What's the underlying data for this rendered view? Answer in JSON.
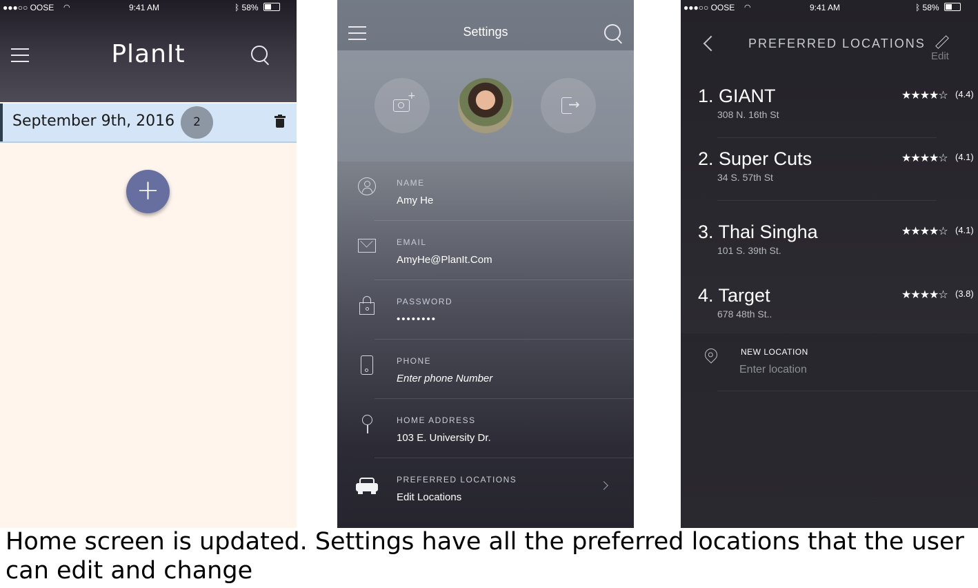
{
  "home": {
    "status": {
      "carrier": "●●●○○ OOSE",
      "time": "9:41 AM",
      "battery": "58%"
    },
    "title": "PlanIt",
    "date_label": "September 9th, 2016",
    "event_count": "2",
    "add_symbol": "+"
  },
  "settings": {
    "title": "Settings",
    "camera_plus": "+",
    "logout_arrow": "→",
    "fields": [
      {
        "label": "NAME",
        "value": "Amy He"
      },
      {
        "label": "EMAIL",
        "value": "AmyHe@PlanIt.Com"
      },
      {
        "label": "PASSWORD",
        "value": "••••••••"
      },
      {
        "label": "PHONE",
        "value": "Enter phone Number"
      },
      {
        "label": "HOME ADDRESS",
        "value": "103 E. University Dr."
      },
      {
        "label": "PREFERRED LOCATIONS",
        "value": "Edit Locations"
      }
    ]
  },
  "locations": {
    "status": {
      "carrier": "●●●○○ OOSE",
      "time": "9:41 AM",
      "battery": "58%"
    },
    "title": "PREFERRED LOCATIONS",
    "edit_label": "Edit",
    "items": [
      {
        "name": "1. GIANT",
        "address": "308 N. 16th St",
        "stars": "★★★★☆",
        "rating": "(4.4)"
      },
      {
        "name": "2. Super Cuts",
        "address": "34 S. 57th St",
        "stars": "★★★★☆",
        "rating": "(4.1)"
      },
      {
        "name": "3. Thai Singha",
        "address": "101 S. 39th St.",
        "stars": "★★★★☆",
        "rating": "(4.1)"
      },
      {
        "name": "4. Target",
        "address": "678 48th St..",
        "stars": "★★★★☆",
        "rating": "(3.8)"
      }
    ],
    "new_location_label": "NEW LOCATION",
    "new_location_placeholder": "Enter location"
  },
  "caption": "Home screen is updated. Settings have all the preferred locations that the user can edit and change",
  "colors": {
    "home_topbar": "#3c3945",
    "home_background": "#fff5ec",
    "date_row": "#d3e5f6",
    "fab": "#666fa0",
    "locations_background": "#26252c"
  }
}
